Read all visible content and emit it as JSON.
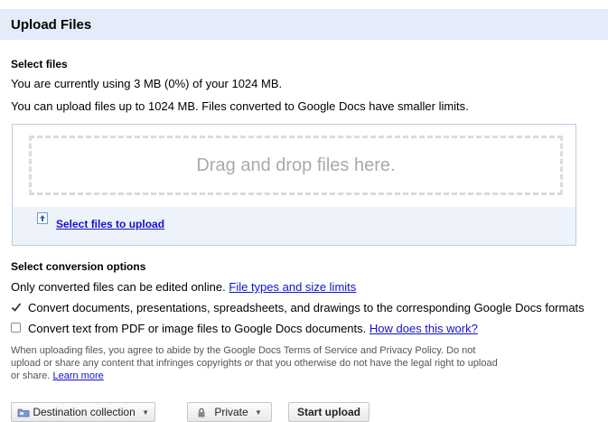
{
  "header": {
    "title": "Upload Files"
  },
  "select_files": {
    "heading": "Select files",
    "usage_text": "You are currently using 3 MB (0%) of your 1024 MB.",
    "limit_text": "You can upload files up to 1024 MB. Files converted to Google Docs have smaller limits."
  },
  "drop_zone": {
    "prompt": "Drag and drop files here.",
    "select_link": "Select files to upload"
  },
  "conversion": {
    "heading": "Select conversion options",
    "note_text": "Only converted files can be edited online.",
    "note_link": "File types and size limits",
    "option1": {
      "label": "Convert documents, presentations, spreadsheets, and drawings to the corresponding Google Docs formats",
      "checked": true
    },
    "option2": {
      "label": "Convert text from PDF or image files to Google Docs documents.",
      "link": "How does this work?",
      "checked": false
    }
  },
  "legal": {
    "text": "When uploading files, you agree to abide by the Google Docs Terms of Service and Privacy Policy. Do not upload or share any content that infringes copyrights or that you otherwise do not have the legal right to upload or share.",
    "link": "Learn more"
  },
  "toolbar": {
    "destination_label": "Destination collection",
    "privacy_label": "Private",
    "start_label": "Start upload"
  },
  "icons": {
    "destination": "folder-icon",
    "privacy": "lock-icon",
    "upload": "upload-arrow-icon",
    "dropdown": "caret-down-icon",
    "checkmark": "checkmark-icon"
  },
  "colors": {
    "header_bg": "#e5ecf9",
    "link": "#1111cc",
    "drop_border": "#bccde8",
    "drop_footer_bg": "#eef3fb"
  }
}
